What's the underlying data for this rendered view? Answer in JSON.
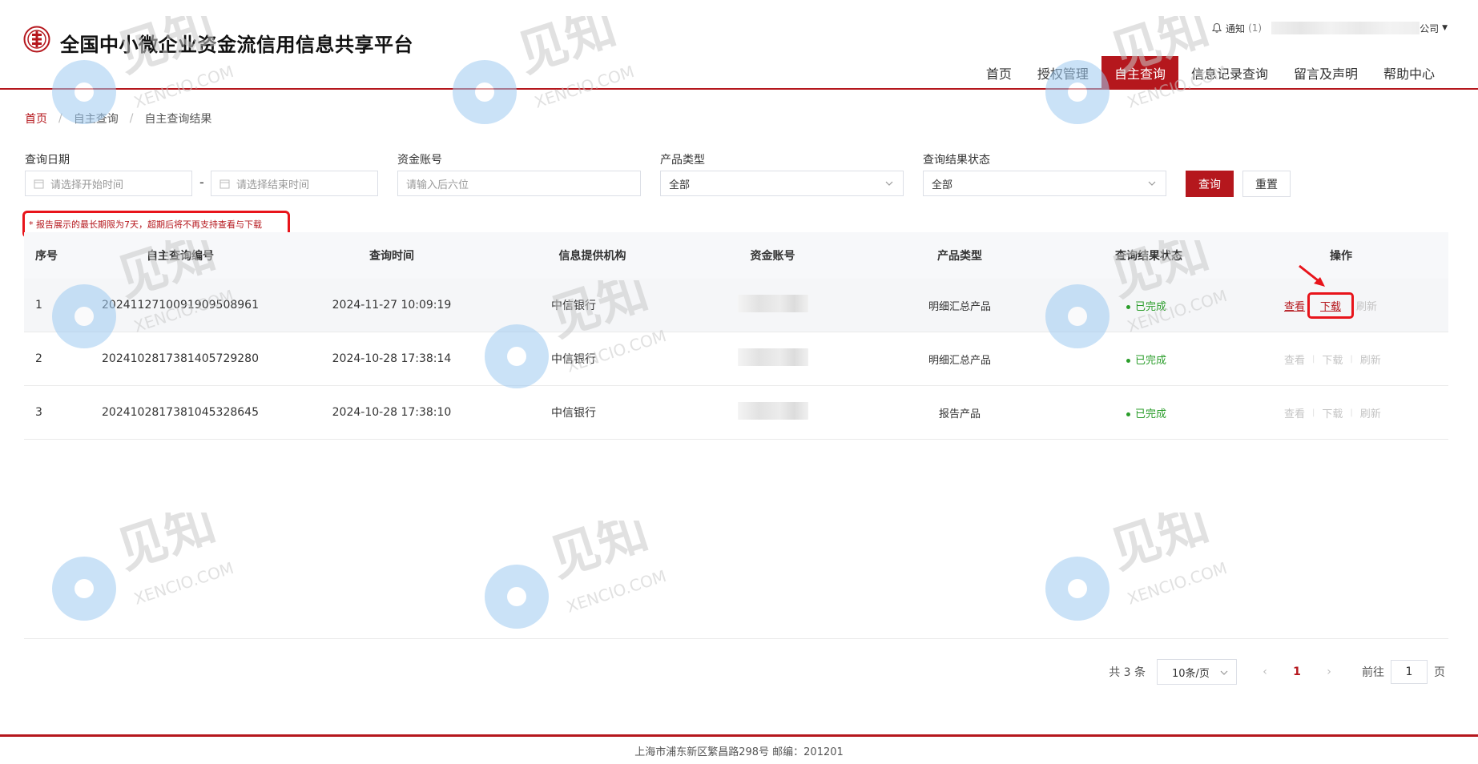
{
  "header": {
    "title": "全国中小微企业资金流信用信息共享平台",
    "notice_label": "通知",
    "notice_count": "(1)",
    "company_suffix": "公司",
    "nav": [
      {
        "label": "首页"
      },
      {
        "label": "授权管理"
      },
      {
        "label": "自主查询",
        "active": true
      },
      {
        "label": "信息记录查询"
      },
      {
        "label": "留言及声明"
      },
      {
        "label": "帮助中心"
      }
    ]
  },
  "breadcrumb": [
    "首页",
    "自主查询",
    "自主查询结果"
  ],
  "filters": {
    "date_label": "查询日期",
    "start_placeholder": "请选择开始时间",
    "end_placeholder": "请选择结束时间",
    "account_label": "资金账号",
    "account_placeholder": "请输入后六位",
    "product_label": "产品类型",
    "product_value": "全部",
    "status_label": "查询结果状态",
    "status_value": "全部",
    "search_label": "查询",
    "reset_label": "重置"
  },
  "notice": "* 报告展示的最长期限为7天，超期后将不再支持查看与下载",
  "table": {
    "headers": [
      "序号",
      "自主查询编号",
      "查询时间",
      "信息提供机构",
      "资金账号",
      "产品类型",
      "查询结果状态",
      "操作"
    ],
    "rows": [
      {
        "idx": "1",
        "no": "20241127100919095089​61",
        "time": "2024-11-27 10:09:19",
        "org": "中信银行",
        "type": "明细汇总产品",
        "status": "已完成"
      },
      {
        "idx": "2",
        "no": "2024102817381405729280",
        "time": "2024-10-28 17:38:14",
        "org": "中信银行",
        "type": "明细汇总产品",
        "status": "已完成"
      },
      {
        "idx": "3",
        "no": "2024102817381045328645",
        "time": "2024-10-28 17:38:10",
        "org": "中信银行",
        "type": "报告产品",
        "status": "已完成"
      }
    ],
    "ops": {
      "view": "查看",
      "download": "下载",
      "refresh": "刷新"
    }
  },
  "pager": {
    "total": "共 3 条",
    "page_size": "10条/页",
    "current": "1",
    "goto_label": "前往",
    "goto_value": "1",
    "page_unit": "页",
    "prev": "‹",
    "next": "›"
  },
  "footer": "上海市浦东新区繁昌路298号 邮编：201201",
  "watermark": {
    "cn": "见知",
    "en": "XENCIO.COM"
  },
  "colors": {
    "brand": "#b5171d",
    "success": "#2a9d2a",
    "highlight": "#e8141b"
  }
}
